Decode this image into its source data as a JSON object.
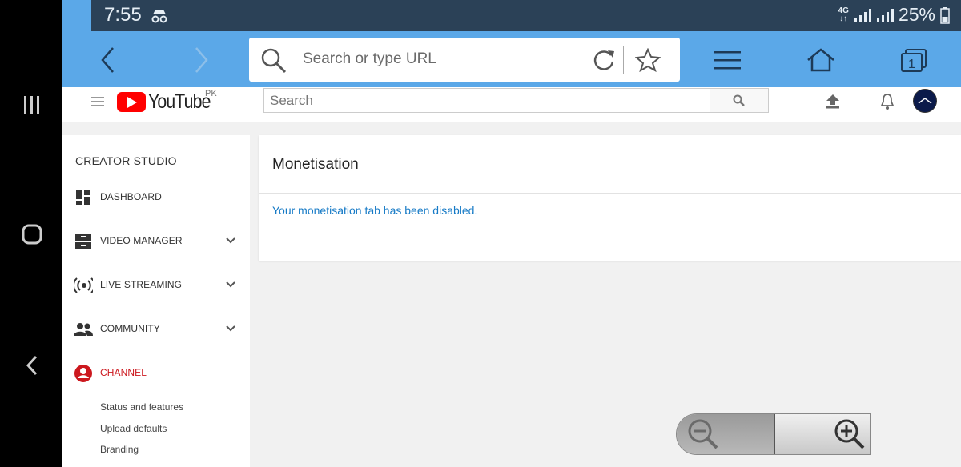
{
  "status_bar": {
    "time": "7:55",
    "network_top": "4G",
    "network_bottom": "↓↑",
    "battery_percent": "25%"
  },
  "browser": {
    "url_placeholder": "Search or type URL",
    "tab_count": "1",
    "icons": [
      "back-icon",
      "forward-icon",
      "search-icon",
      "reload-icon",
      "star-icon",
      "menu-icon",
      "home-icon",
      "tabs-icon"
    ]
  },
  "youtube": {
    "logo_text": "YouTube",
    "region": "PK",
    "search_placeholder": "Search"
  },
  "sidebar": {
    "title": "CREATOR STUDIO",
    "items": [
      {
        "label": "DASHBOARD",
        "icon": "dashboard-icon"
      },
      {
        "label": "VIDEO MANAGER",
        "icon": "video-manager-icon"
      },
      {
        "label": "LIVE STREAMING",
        "icon": "live-streaming-icon"
      },
      {
        "label": "COMMUNITY",
        "icon": "community-icon"
      },
      {
        "label": "CHANNEL",
        "icon": "channel-icon"
      }
    ],
    "sub_items": [
      "Status and features",
      "Upload defaults",
      "Branding"
    ]
  },
  "main": {
    "heading": "Monetisation",
    "message": "Your monetisation tab has been disabled."
  },
  "colors": {
    "toolbar": "#5ba8e8",
    "statusbar": "#2b4157",
    "channel_active": "#cc181e",
    "link_blue": "#167ac6"
  }
}
